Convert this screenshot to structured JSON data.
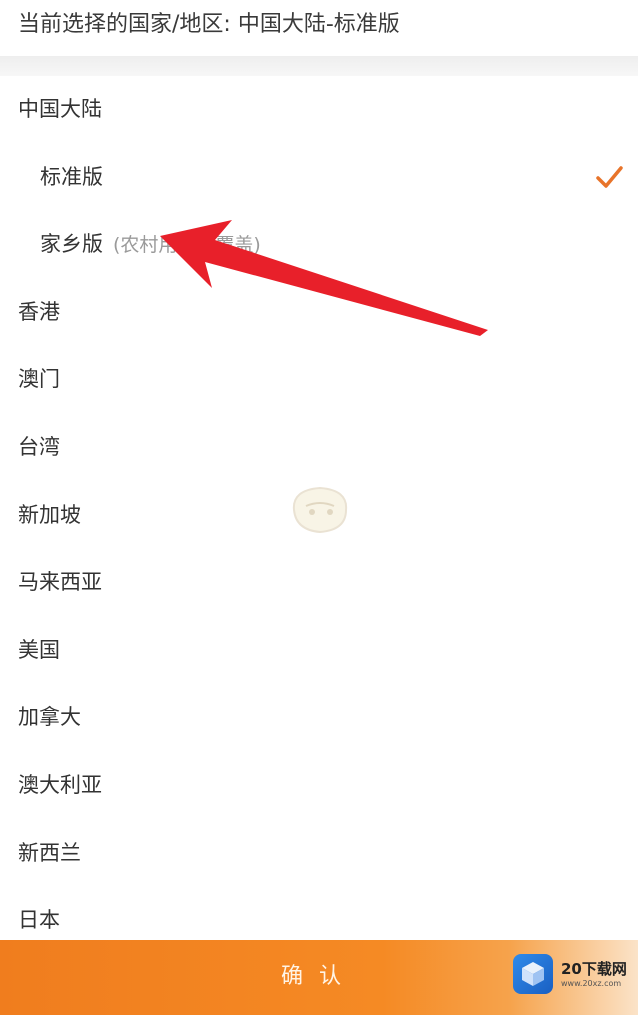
{
  "header": {
    "current_selection": "当前选择的国家/地区: 中国大陆-标准版"
  },
  "regions": [
    {
      "label": "中国大陆",
      "kind": "region"
    },
    {
      "label": "标准版",
      "kind": "sub",
      "selected": true
    },
    {
      "label": "家乡版",
      "kind": "sub",
      "note": "(农村用户全覆盖)"
    },
    {
      "label": "香港",
      "kind": "region"
    },
    {
      "label": "澳门",
      "kind": "region"
    },
    {
      "label": "台湾",
      "kind": "region"
    },
    {
      "label": "新加坡",
      "kind": "region"
    },
    {
      "label": "马来西亚",
      "kind": "region"
    },
    {
      "label": "美国",
      "kind": "region"
    },
    {
      "label": "加拿大",
      "kind": "region"
    },
    {
      "label": "澳大利亚",
      "kind": "region"
    },
    {
      "label": "新西兰",
      "kind": "region"
    },
    {
      "label": "日本",
      "kind": "region"
    }
  ],
  "confirm": {
    "label": "确认"
  },
  "watermark": {
    "brand": "20下载网",
    "site": "www.20xz.com"
  },
  "colors": {
    "accent": "#f07d1e",
    "check": "#e8742a",
    "arrow": "#e8202a"
  },
  "icons": {
    "selected": "check-icon",
    "annotation": "red-arrow-icon"
  }
}
